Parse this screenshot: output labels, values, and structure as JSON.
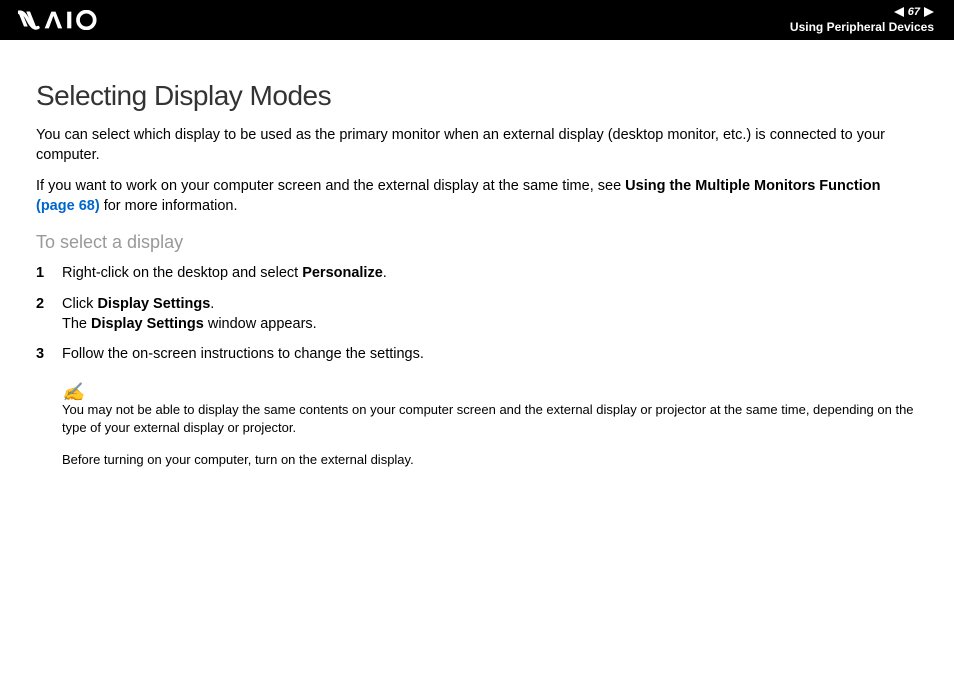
{
  "header": {
    "page_number": "67",
    "section": "Using Peripheral Devices"
  },
  "content": {
    "heading": "Selecting Display Modes",
    "intro1": "You can select which display to be used as the primary monitor when an external display (desktop monitor, etc.) is connected to your computer.",
    "intro2_pre": "If you want to work on your computer screen and the external display at the same time, see ",
    "intro2_bold": "Using the Multiple Monitors Function ",
    "intro2_link": "(page 68)",
    "intro2_post": " for more information.",
    "subheading": "To select a display",
    "steps": [
      {
        "num": "1",
        "pre": "Right-click on the desktop and select ",
        "bold": "Personalize",
        "post": "."
      },
      {
        "num": "2",
        "line1_pre": "Click ",
        "line1_bold": "Display Settings",
        "line1_post": ".",
        "line2_pre": "The ",
        "line2_bold": "Display Settings",
        "line2_post": " window appears."
      },
      {
        "num": "3",
        "text": "Follow the on-screen instructions to change the settings."
      }
    ],
    "note1": "You may not be able to display the same contents on your computer screen and the external display or projector at the same time, depending on the type of your external display or projector.",
    "note2": "Before turning on your computer, turn on the external display."
  }
}
